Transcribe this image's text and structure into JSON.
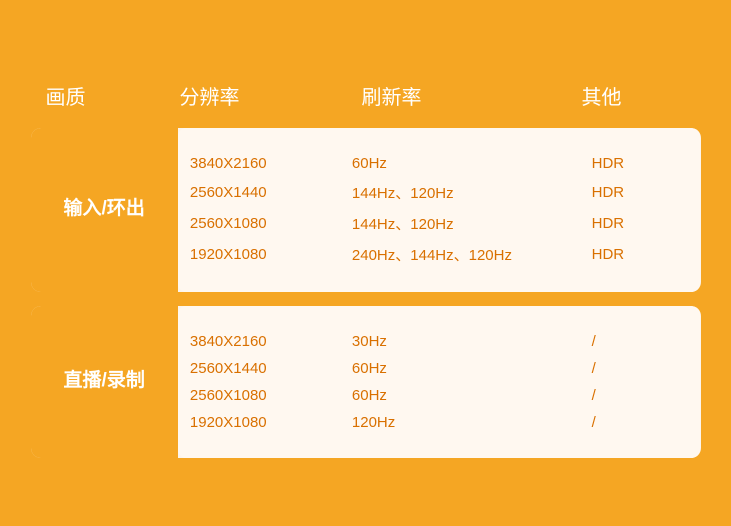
{
  "header": {
    "quality_label": "画质",
    "resolution_label": "分辨率",
    "refresh_label": "刷新率",
    "other_label": "其他"
  },
  "sections": [
    {
      "id": "input-output",
      "label": "输入/环出",
      "rows": [
        {
          "resolution": "3840X2160",
          "refresh": "60Hz",
          "other": "HDR"
        },
        {
          "resolution": "2560X1440",
          "refresh": "144Hz、120Hz",
          "other": "HDR"
        },
        {
          "resolution": "2560X1080",
          "refresh": "144Hz、120Hz",
          "other": "HDR"
        },
        {
          "resolution": "1920X1080",
          "refresh": "240Hz、144Hz、120Hz",
          "other": "HDR"
        }
      ]
    },
    {
      "id": "live-record",
      "label": "直播/录制",
      "rows": [
        {
          "resolution": "3840X2160",
          "refresh": "30Hz",
          "other": "/"
        },
        {
          "resolution": "2560X1440",
          "refresh": "60Hz",
          "other": "/"
        },
        {
          "resolution": "2560X1080",
          "refresh": "60Hz",
          "other": "/"
        },
        {
          "resolution": "1920X1080",
          "refresh": "120Hz",
          "other": "/"
        }
      ]
    }
  ],
  "colors": {
    "bg": "#f5a623",
    "card_bg": "#fdf5eb",
    "text_header": "#ffffff",
    "text_data": "#d97000"
  }
}
